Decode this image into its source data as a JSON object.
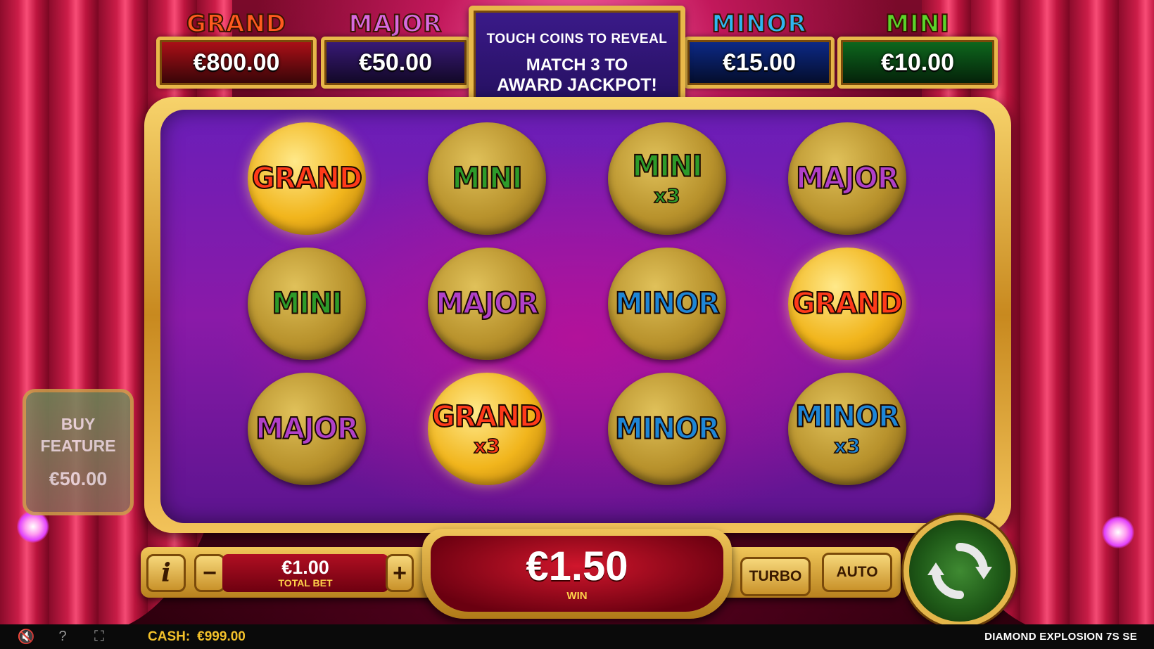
{
  "jackpots": [
    {
      "name": "GRAND",
      "value": "€800.00",
      "title_color": "#ff5a1f",
      "box_color": "#b01018"
    },
    {
      "name": "MAJOR",
      "value": "€50.00",
      "title_color": "#d76ae0",
      "box_color": "#3a1a7a"
    },
    {
      "name": "MINOR",
      "value": "€15.00",
      "title_color": "#2fb6f0",
      "box_color": "#0d2a8a"
    },
    {
      "name": "MINI",
      "value": "€10.00",
      "title_color": "#5ad42a",
      "box_color": "#0e6a1e"
    }
  ],
  "banner": {
    "line1": "TOUCH COINS TO REVEAL",
    "line2": "MATCH 3 TO",
    "line3": "AWARD JACKPOT!"
  },
  "coins": [
    {
      "label": "GRAND",
      "mult": "",
      "state": "bright"
    },
    {
      "label": "MINI",
      "mult": "",
      "state": "dim"
    },
    {
      "label": "MINI",
      "mult": "x3",
      "state": "dim"
    },
    {
      "label": "MAJOR",
      "mult": "",
      "state": "dim"
    },
    {
      "label": "MINI",
      "mult": "",
      "state": "dim"
    },
    {
      "label": "MAJOR",
      "mult": "",
      "state": "dim"
    },
    {
      "label": "MINOR",
      "mult": "",
      "state": "dim"
    },
    {
      "label": "GRAND",
      "mult": "",
      "state": "bright"
    },
    {
      "label": "MAJOR",
      "mult": "",
      "state": "dim"
    },
    {
      "label": "GRAND",
      "mult": "x3",
      "state": "bright"
    },
    {
      "label": "MINOR",
      "mult": "",
      "state": "dim"
    },
    {
      "label": "MINOR",
      "mult": "x3",
      "state": "dim"
    }
  ],
  "coin_colors": {
    "GRAND": "#ff3a1a",
    "MAJOR": "#b040c8",
    "MINOR": "#1e86d6",
    "MINI": "#2e9a2a"
  },
  "buy_feature": {
    "line1": "BUY",
    "line2": "FEATURE",
    "price": "€50.00"
  },
  "controls": {
    "info": "i",
    "minus": "−",
    "plus": "+",
    "bet_value": "€1.00",
    "bet_label": "TOTAL BET",
    "win_value": "€1.50",
    "win_label": "WIN",
    "turbo": "TURBO",
    "auto": "AUTO",
    "spin_icon": "refresh-arrows-icon"
  },
  "footer": {
    "mute_icon": "🔇",
    "help_icon": "?",
    "fullscreen_icon": "⛶",
    "cash_label": "CASH:",
    "cash_value": "€999.00",
    "game_title": "DIAMOND EXPLOSION 7S SE"
  }
}
